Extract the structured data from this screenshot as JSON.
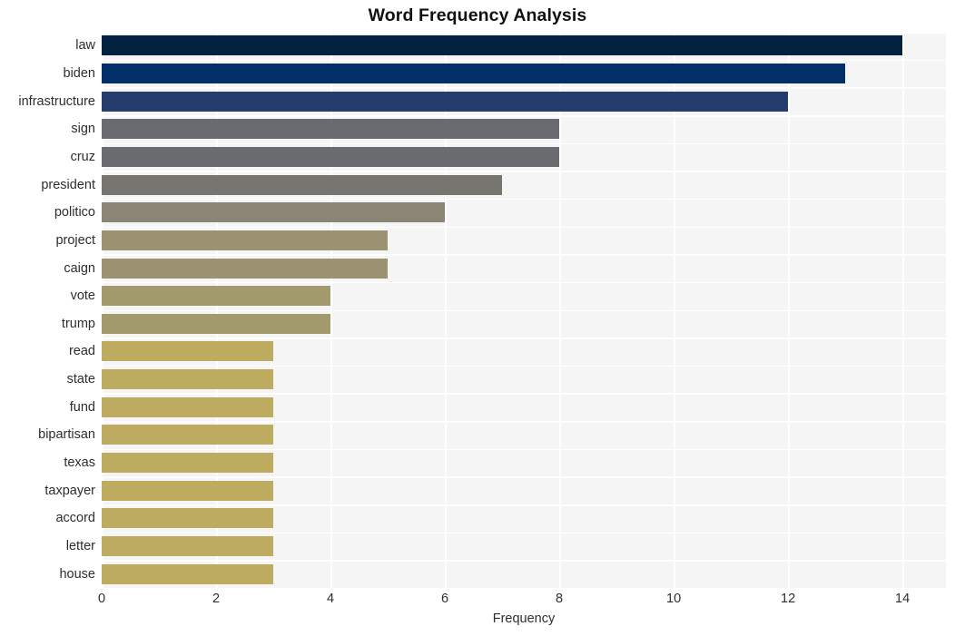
{
  "chart_data": {
    "type": "bar",
    "orientation": "horizontal",
    "title": "Word Frequency Analysis",
    "xlabel": "Frequency",
    "ylabel": "",
    "xlim": [
      0,
      14.76
    ],
    "xticks": [
      0,
      2,
      4,
      6,
      8,
      10,
      12,
      14
    ],
    "xtick_labels": [
      "0",
      "2",
      "4",
      "6",
      "8",
      "10",
      "12",
      "14"
    ],
    "grid": true,
    "legend": false,
    "categories": [
      "law",
      "biden",
      "infrastructure",
      "sign",
      "cruz",
      "president",
      "politico",
      "project",
      "caign",
      "vote",
      "trump",
      "read",
      "state",
      "fund",
      "bipartisan",
      "texas",
      "taxpayer",
      "accord",
      "letter",
      "house"
    ],
    "values": [
      14,
      13,
      12,
      8,
      8,
      7,
      6,
      5,
      5,
      4,
      4,
      3,
      3,
      3,
      3,
      3,
      3,
      3,
      3,
      3
    ],
    "bar_colors": [
      "#032242",
      "#04306a",
      "#253c6e",
      "#6a6b70",
      "#6b6c70",
      "#77756f",
      "#8b8575",
      "#9a9271",
      "#9a9271",
      "#a39a6e",
      "#a39a6e",
      "#bdac5f",
      "#bdac5f",
      "#bdac5f",
      "#bdac5f",
      "#bdac5f",
      "#bdac5f",
      "#bdac5f",
      "#bdac5f",
      "#bdac5f"
    ],
    "plot_background": "#f5f5f5",
    "grid_color": "#ffffff",
    "figure_background": "#ffffff"
  }
}
